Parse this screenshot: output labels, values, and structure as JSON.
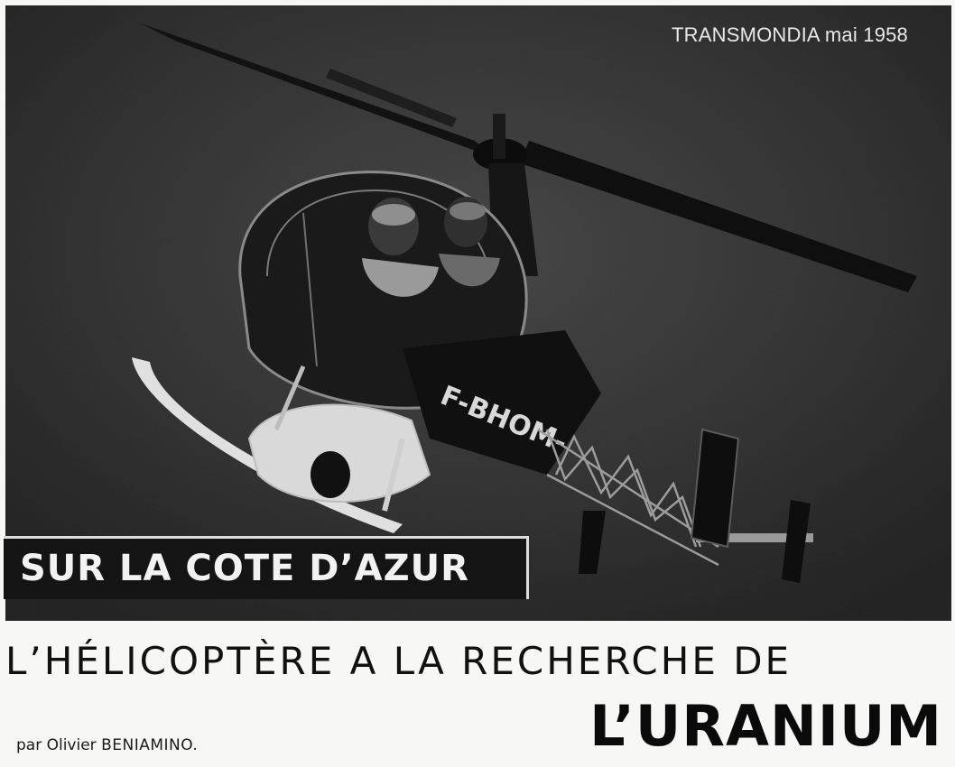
{
  "photo": {
    "credit": "TRANSMONDIA mai 1958",
    "registration": "F-BHOM-",
    "icon": "helicopter-photo"
  },
  "banner": {
    "text": "SUR LA COTE D’AZUR"
  },
  "headline": {
    "line1": "L’HÉLICOPTÈRE A LA RECHERCHE DE",
    "line2": "L’URANIUM"
  },
  "byline": {
    "prefix": "par Olivier",
    "author": "BENIAMINO."
  },
  "colors": {
    "photo_background": "#2e2e2e",
    "banner_background": "#141414",
    "text": "#111111"
  }
}
